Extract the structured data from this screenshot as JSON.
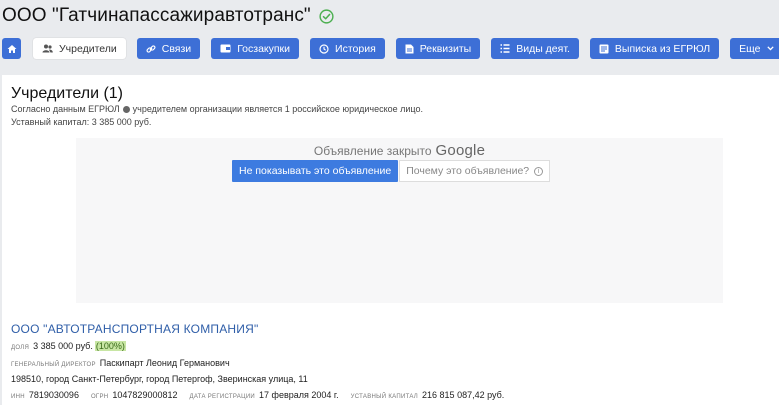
{
  "header": {
    "title": "ООО \"Гатчинапассажиравтотранс\""
  },
  "nav": {
    "items": [
      {
        "label": "Учредители"
      },
      {
        "label": "Связи"
      },
      {
        "label": "Госзакупки"
      },
      {
        "label": "История"
      },
      {
        "label": "Реквизиты"
      },
      {
        "label": "Виды деят."
      },
      {
        "label": "Выписка из ЕГРЮЛ"
      },
      {
        "label": "Еще"
      }
    ]
  },
  "section": {
    "title": "Учредители (1)",
    "note_prefix": "Согласно данным ЕГРЮЛ",
    "note_suffix": "учредителем организации является 1 российское юридическое лицо.",
    "capital": "Уставный капитал: 3 385 000 руб."
  },
  "ad": {
    "closed_text": "Объявление закрыто",
    "brand": "Google",
    "hide_label": "Не показывать это объявление",
    "why_label": "Почему это объявление?",
    "info_glyph": "i"
  },
  "founder": {
    "name": "ООО \"АВТОТРАНСПОРТНАЯ КОМПАНИЯ\"",
    "share_label": "доля",
    "share_value": "3 385 000 руб.",
    "share_percent": "(100%)",
    "director_label": "генеральный директор",
    "director_name": "Паскипарт Леонид Германович",
    "address": "198510, город Санкт-Петербург, город Петергоф, Зверинская улица, 11",
    "inn_label": "ИНН",
    "inn": "7819030096",
    "ogrn_label": "ОГРН",
    "ogrn": "1047829000812",
    "regdate_label": "дата регистрации",
    "regdate": "17 февраля 2004 г.",
    "capital_label": "уставный капитал",
    "capital": "216 815 087,42 руб."
  },
  "colors": {
    "accent": "#3d6fd6",
    "link": "#2f5ea8",
    "verified": "#4caf50"
  }
}
